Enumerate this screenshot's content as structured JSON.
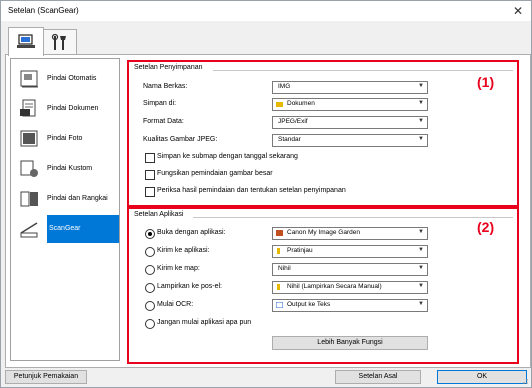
{
  "window": {
    "title": "Setelan (ScanGear)"
  },
  "tabs": [
    {
      "name": "scanner-settings-tab",
      "icon": "computer-icon"
    },
    {
      "name": "tools-settings-tab",
      "icon": "tools-icon"
    }
  ],
  "sidebar": {
    "items": [
      {
        "label": "Pindai Otomatis",
        "icon": "auto-scan-icon"
      },
      {
        "label": "Pindai Dokumen",
        "icon": "document-scan-icon"
      },
      {
        "label": "Pindai Foto",
        "icon": "photo-scan-icon"
      },
      {
        "label": "Pindai Kustom",
        "icon": "custom-scan-icon"
      },
      {
        "label": "Pindai dan Rangkai",
        "icon": "stitch-scan-icon"
      },
      {
        "label": "ScanGear",
        "icon": "scangear-icon"
      }
    ]
  },
  "save_settings": {
    "title": "Setelan Penyimpanan",
    "callout": "(1)",
    "file_name_label": "Nama Berkas:",
    "file_name_value": "IMG",
    "save_in_label": "Simpan di:",
    "save_in_value": "Dokumen",
    "data_format_label": "Format Data:",
    "data_format_value": "JPEG/Exif",
    "jpeg_quality_label": "Kualitas Gambar JPEG:",
    "jpeg_quality_value": "Standar",
    "checkboxes": [
      "Simpan ke submap dengan tanggal sekarang",
      "Fungsikan pemindaian gambar besar",
      "Periksa hasil pemindaian dan tentukan setelan penyimpanan"
    ]
  },
  "app_settings": {
    "title": "Setelan Aplikasi",
    "callout": "(2)",
    "options": [
      {
        "label": "Buka dengan aplikasi:",
        "value": "Canon My Image Garden",
        "selected": true
      },
      {
        "label": "Kirim ke aplikasi:",
        "value": "Pratinjau",
        "selected": false
      },
      {
        "label": "Kirim ke map:",
        "value": "Nihil",
        "selected": false
      },
      {
        "label": "Lampirkan ke pos-el:",
        "value": "Nihil (Lampirkan Secara Manual)",
        "selected": false
      },
      {
        "label": "Mulai OCR:",
        "value": "Output ke Teks",
        "selected": false
      },
      {
        "label": "Jangan mulai aplikasi apa pun",
        "value": "",
        "selected": false
      }
    ],
    "more_functions_label": "Lebih Banyak Fungsi"
  },
  "footer": {
    "instructions_label": "Petunjuk Pemakaian",
    "defaults_label": "Setelan Asal",
    "ok_label": "OK"
  },
  "colors": {
    "selection": "#0078d7",
    "callout": "#e8001c"
  }
}
